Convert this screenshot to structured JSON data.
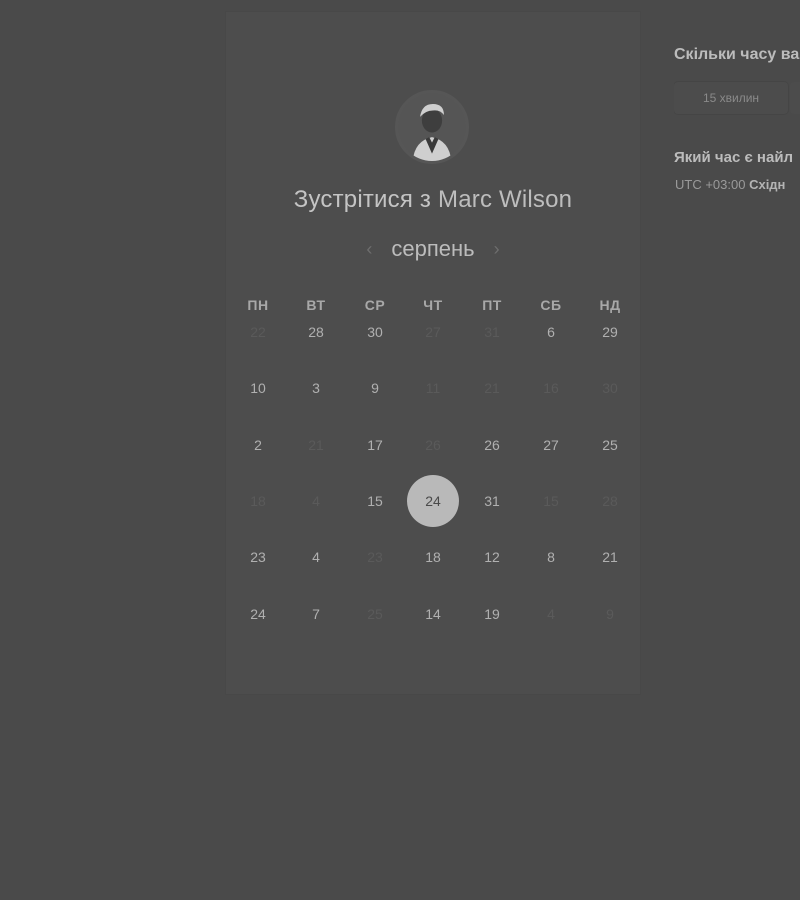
{
  "meeting": {
    "title_prefix": "Зустрітися з",
    "host_name": "Marc Wilson"
  },
  "calendar": {
    "month_label": "серпень",
    "prev_label": "‹",
    "next_label": "›",
    "weekdays": [
      "ПН",
      "ВТ",
      "СР",
      "ЧТ",
      "ПТ",
      "СБ",
      "НД"
    ],
    "rows": [
      [
        {
          "t": "22",
          "dim": true
        },
        {
          "t": "28",
          "dim": false
        },
        {
          "t": "30",
          "dim": false
        },
        {
          "t": "27",
          "dim": true
        },
        {
          "t": "31",
          "dim": true
        },
        {
          "t": "6",
          "dim": false
        },
        {
          "t": "29",
          "dim": false
        }
      ],
      [
        {
          "t": "10",
          "dim": false
        },
        {
          "t": "3",
          "dim": false
        },
        {
          "t": "9",
          "dim": false
        },
        {
          "t": "11",
          "dim": true
        },
        {
          "t": "21",
          "dim": true
        },
        {
          "t": "16",
          "dim": true
        },
        {
          "t": "30",
          "dim": true
        }
      ],
      [
        {
          "t": "2",
          "dim": false
        },
        {
          "t": "21",
          "dim": true
        },
        {
          "t": "17",
          "dim": false
        },
        {
          "t": "26",
          "dim": true
        },
        {
          "t": "26",
          "dim": false
        },
        {
          "t": "27",
          "dim": false
        },
        {
          "t": "25",
          "dim": false
        }
      ],
      [
        {
          "t": "18",
          "dim": true
        },
        {
          "t": "4",
          "dim": true
        },
        {
          "t": "15",
          "dim": false
        },
        {
          "t": "24",
          "dim": false,
          "selected": true
        },
        {
          "t": "31",
          "dim": false
        },
        {
          "t": "15",
          "dim": true
        },
        {
          "t": "28",
          "dim": true
        }
      ],
      [
        {
          "t": "23",
          "dim": false
        },
        {
          "t": "4",
          "dim": false
        },
        {
          "t": "23",
          "dim": true
        },
        {
          "t": "18",
          "dim": false
        },
        {
          "t": "12",
          "dim": false
        },
        {
          "t": "8",
          "dim": false
        },
        {
          "t": "21",
          "dim": false
        }
      ],
      [
        {
          "t": "24",
          "dim": false
        },
        {
          "t": "7",
          "dim": false
        },
        {
          "t": "25",
          "dim": true
        },
        {
          "t": "14",
          "dim": false
        },
        {
          "t": "19",
          "dim": false
        },
        {
          "t": "4",
          "dim": true
        },
        {
          "t": "9",
          "dim": true
        }
      ]
    ]
  },
  "sidebar": {
    "duration_question": "Скільки часу вам",
    "duration_option": "15 хвилин",
    "time_question": "Який час є найл",
    "timezone_offset": "UTC +03:00",
    "timezone_name": "Східн"
  }
}
